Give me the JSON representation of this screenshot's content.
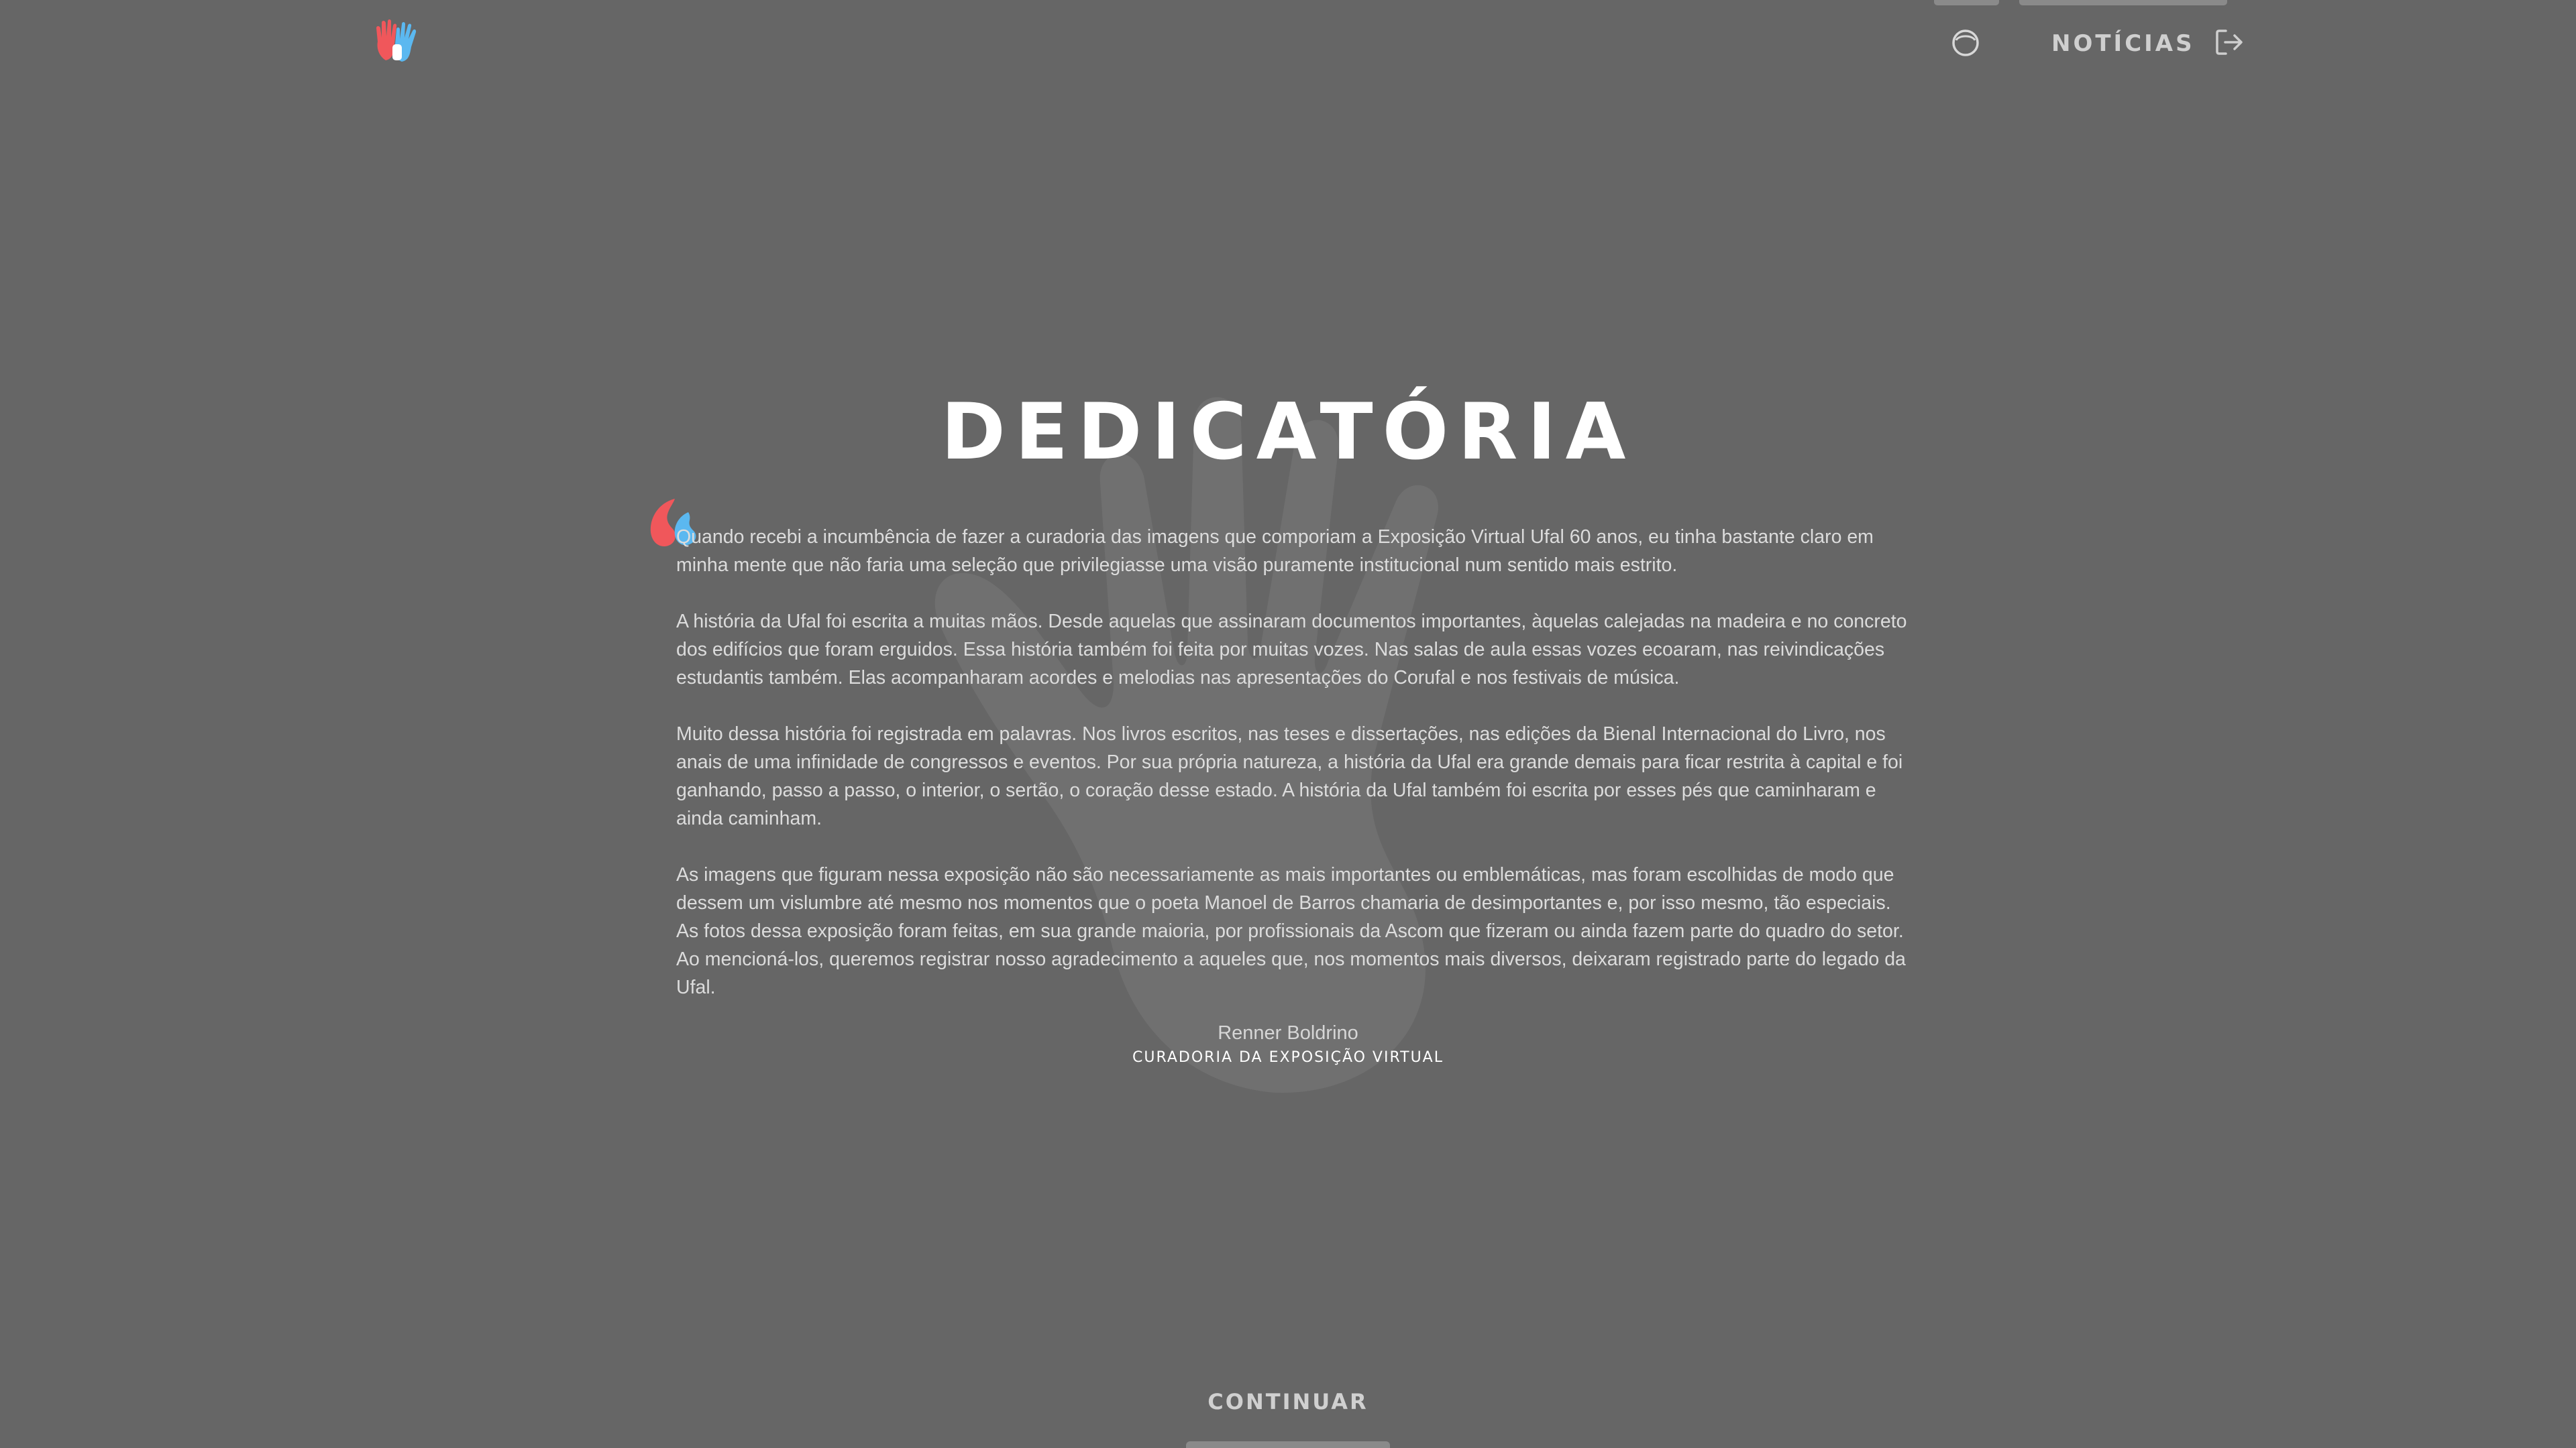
{
  "header": {
    "logo_icon": "colored-hands-logo-icon",
    "circle_icon": "circle-outline-icon",
    "news_label": "NOTÍCIAS",
    "news_icon": "exit-arrow-icon"
  },
  "main": {
    "title": "DEDICATÓRIA",
    "quote_icon": "quote-mark-icon",
    "paragraphs": [
      "Quando recebi a incumbência de fazer a curadoria das imagens que comporiam a Exposição Virtual Ufal 60 anos, eu tinha bastante claro em minha mente que não faria uma seleção que privilegiasse uma visão puramente institucional num sentido mais estrito.",
      "A história da Ufal foi escrita a muitas mãos. Desde aquelas que assinaram documentos importantes, àquelas calejadas na madeira e no concreto dos edifícios que foram erguidos.  Essa história também foi feita por muitas vozes. Nas salas de aula essas vozes ecoaram, nas reivindicações estudantis também. Elas acompanharam acordes e melodias nas apresentações do Corufal e nos festivais de música.",
      "Muito dessa história foi registrada em palavras. Nos livros escritos, nas teses e dissertações, nas edições da Bienal Internacional do Livro, nos anais de uma infinidade de congressos e eventos. Por sua própria natureza, a história da Ufal era grande demais para ficar restrita à capital e foi ganhando, passo a passo, o interior, o sertão, o coração desse estado. A história da Ufal também foi escrita por esses pés que caminharam e ainda caminham.",
      "As imagens que figuram nessa exposição não são necessariamente as mais importantes ou emblemáticas, mas foram escolhidas de modo que dessem um vislumbre até mesmo nos momentos que o poeta Manoel de Barros chamaria de desimportantes e, por isso mesmo, tão especiais. As fotos dessa exposição foram feitas, em sua grande maioria, por profissionais da Ascom que fizeram ou ainda fazem parte do quadro do setor. Ao mencioná-los, queremos registrar nosso agradecimento a aqueles que, nos momentos mais diversos, deixaram registrado parte do legado da Ufal."
    ],
    "signature_name": "Renner Boldrino",
    "signature_role": "CURADORIA DA EXPOSIÇÃO VIRTUAL",
    "watermark_icon": "hand-watermark-icon"
  },
  "footer": {
    "continue_label": "CONTINUAR"
  },
  "colors": {
    "background": "#666666",
    "accent_red": "#f0575b",
    "accent_blue": "#5bb8f0"
  }
}
